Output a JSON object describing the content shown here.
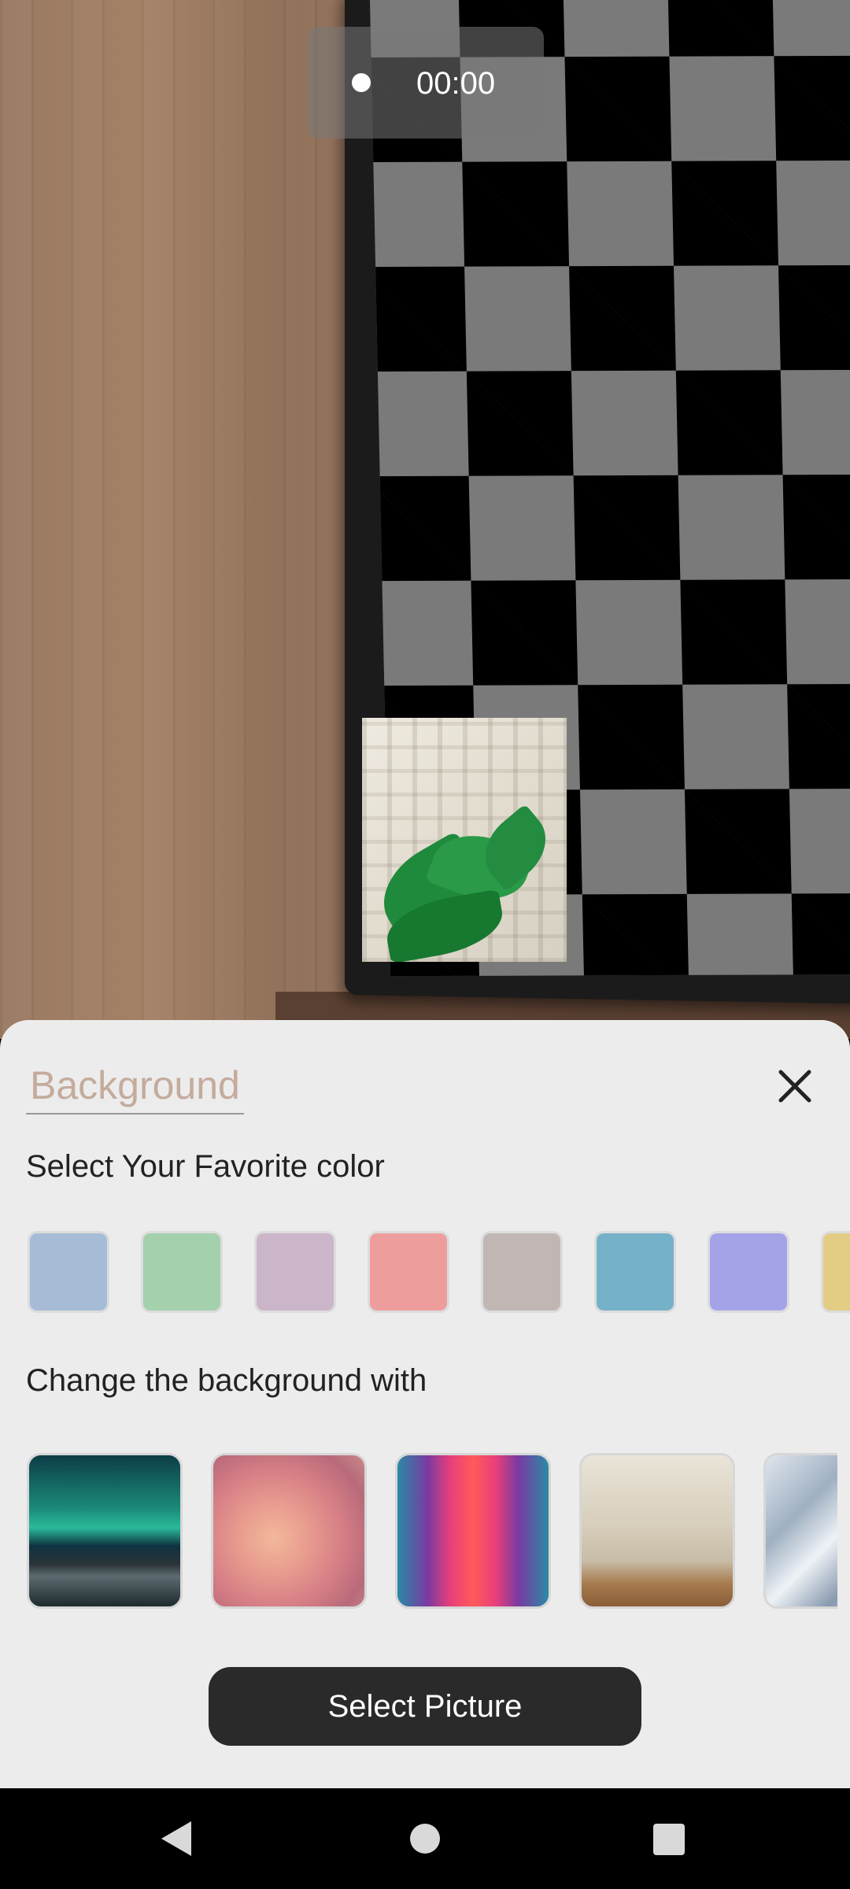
{
  "recorder": {
    "time": "00:00"
  },
  "sheet": {
    "title": "Background",
    "color_label": "Select Your Favorite color",
    "colors": [
      "#a6bcd6",
      "#a4d0ad",
      "#cbb5c9",
      "#ee9d9d",
      "#c0b7b5",
      "#75b1c8",
      "#a4a3e8",
      "#e3cc84"
    ],
    "image_label": "Change the background with",
    "images": [
      "aurora-mountains",
      "pink-clouds-sky",
      "neon-corridor",
      "living-room-interior",
      "geometric-crystal"
    ],
    "button_label": "Select Picture"
  },
  "nav": {
    "back": "back-icon",
    "home": "home-icon",
    "recents": "recents-icon"
  }
}
